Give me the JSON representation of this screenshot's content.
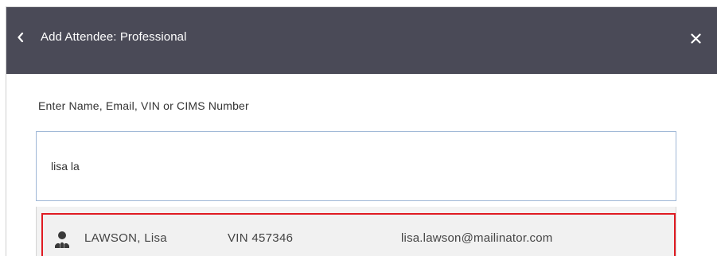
{
  "dialog": {
    "title": "Add Attendee: Professional",
    "back_icon": "chevron-left-icon",
    "close_icon": "close-icon",
    "header_color": "#4a4a57"
  },
  "search": {
    "label": "Enter Name, Email, VIN or CIMS Number",
    "value": "lisa la",
    "border_color": "#9fb7d6"
  },
  "results": [
    {
      "icon": "person-group-icon",
      "name": "LAWSON, Lisa",
      "vin": "VIN 457346",
      "email": "lisa.lawson@mailinator.com",
      "highlight_color": "#e01b22"
    }
  ]
}
